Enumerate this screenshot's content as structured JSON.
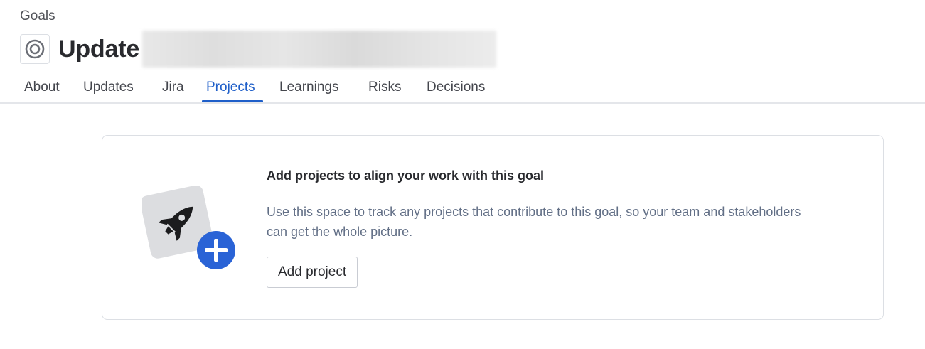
{
  "breadcrumb": {
    "label": "Goals"
  },
  "header": {
    "title": "Update",
    "icon": "goal-target-icon"
  },
  "tabs": [
    {
      "label": "About",
      "active": false
    },
    {
      "label": "Updates",
      "active": false
    },
    {
      "label": "Jira",
      "active": false
    },
    {
      "label": "Projects",
      "active": true
    },
    {
      "label": "Learnings",
      "active": false
    },
    {
      "label": "Risks",
      "active": false
    },
    {
      "label": "Decisions",
      "active": false
    }
  ],
  "empty_state": {
    "heading": "Add projects to align your work with this goal",
    "description": "Use this space to track any projects that contribute to this goal, so your team and stakeholders can get the whole picture.",
    "button_label": "Add project",
    "illustration": "rocket-with-plus-icon"
  },
  "colors": {
    "accent": "#1f5fc9",
    "plus_badge": "#2a63d6",
    "muted_text": "#626f86"
  }
}
